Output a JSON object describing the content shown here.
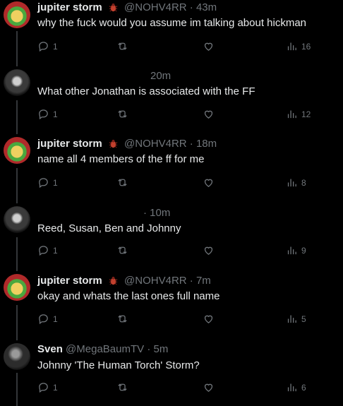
{
  "tweets": [
    {
      "name": "jupiter storm",
      "handle": "@NOHV4RR",
      "sep": "·",
      "time": "43m",
      "text": "why the fuck would you assume im talking about hickman",
      "replies": "1",
      "views": "16",
      "avatar": "red-green-avatar",
      "has_bug": true
    },
    {
      "name": "",
      "handle": "",
      "sep": "",
      "time": "20m",
      "text": "What other Jonathan is associated with the FF",
      "replies": "1",
      "views": "12",
      "avatar": "dark-avatar",
      "has_bug": false
    },
    {
      "name": "jupiter storm",
      "handle": "@NOHV4RR",
      "sep": "·",
      "time": "18m",
      "text": "name all 4 members of the ff for me",
      "replies": "1",
      "views": "8",
      "avatar": "red-green-avatar",
      "has_bug": true
    },
    {
      "name": "",
      "handle": "",
      "sep": "·",
      "time": "10m",
      "text": "Reed, Susan, Ben and Johnny",
      "replies": "1",
      "views": "9",
      "avatar": "dark-avatar",
      "has_bug": false
    },
    {
      "name": "jupiter storm",
      "handle": "@NOHV4RR",
      "sep": "·",
      "time": "7m",
      "text": "okay and whats the last ones full name",
      "replies": "1",
      "views": "5",
      "avatar": "red-green-avatar",
      "has_bug": true
    },
    {
      "name": "Sven",
      "handle": "@MegaBaumTV",
      "sep": "·",
      "time": "5m",
      "text": "Johnny 'The Human Torch' Storm?",
      "replies": "1",
      "views": "6",
      "avatar": "dark-avatar",
      "has_bug": false
    }
  ],
  "colors": {
    "background": "#000000",
    "text": "#e7e9ea",
    "muted": "#71767b",
    "thread_line": "#333639",
    "bug": "#c2402d"
  }
}
